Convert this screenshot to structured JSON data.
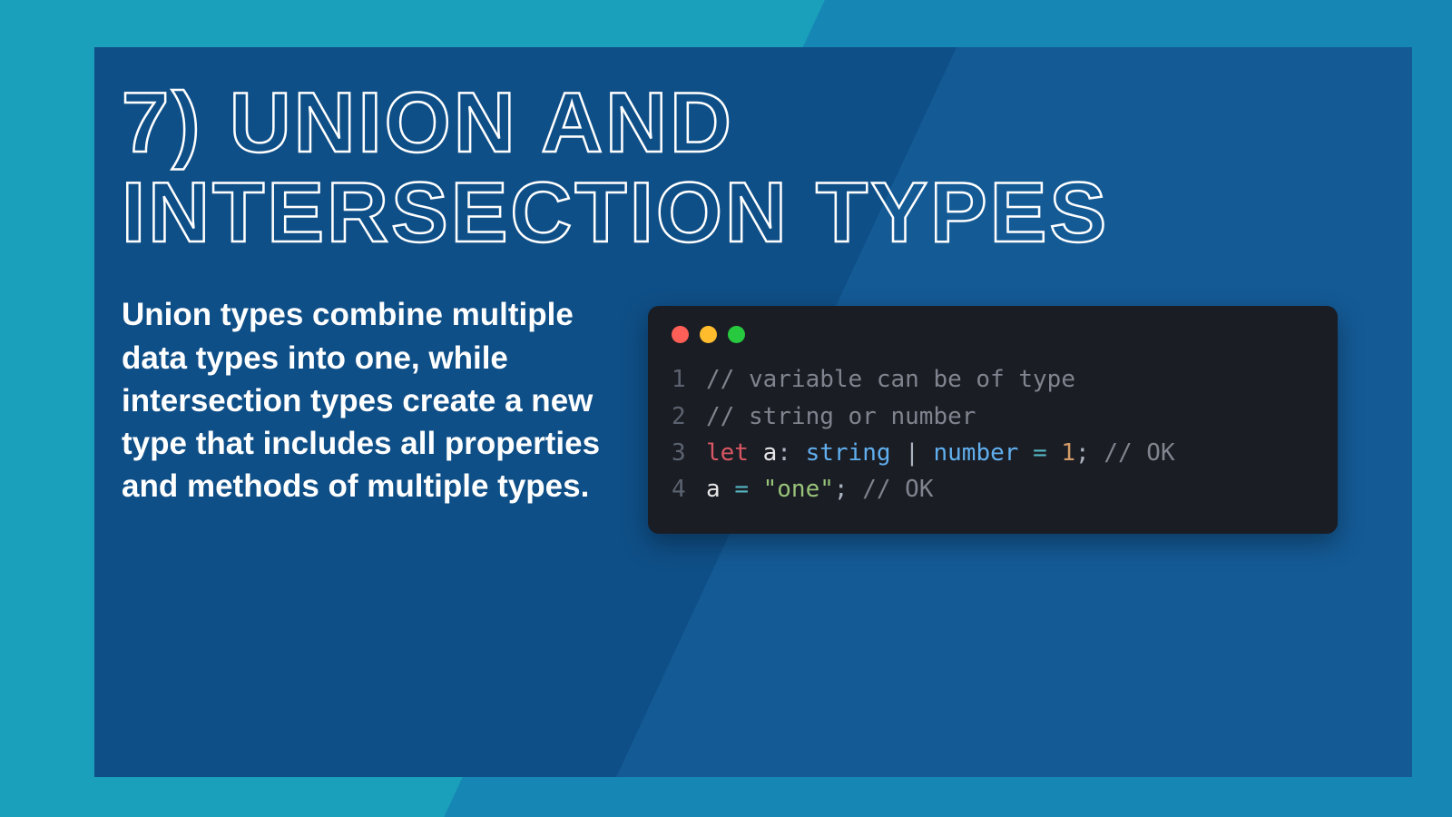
{
  "title": "7) Union and Intersection Types",
  "description": "Union types combine multiple data types into one, while intersection types create a new type that includes all properties and methods of multiple types.",
  "code": {
    "lines": [
      {
        "n": "1",
        "tokens": [
          {
            "t": "// variable can be of type",
            "c": "cmt"
          }
        ]
      },
      {
        "n": "2",
        "tokens": [
          {
            "t": "// string or number",
            "c": "cmt"
          }
        ]
      },
      {
        "n": "3",
        "tokens": [
          {
            "t": "let",
            "c": "kw2"
          },
          {
            "t": " ",
            "c": ""
          },
          {
            "t": "a",
            "c": "id"
          },
          {
            "t": ": ",
            "c": "punc"
          },
          {
            "t": "string",
            "c": "type"
          },
          {
            "t": " | ",
            "c": "punc"
          },
          {
            "t": "number",
            "c": "type"
          },
          {
            "t": " ",
            "c": ""
          },
          {
            "t": "=",
            "c": "op"
          },
          {
            "t": " ",
            "c": ""
          },
          {
            "t": "1",
            "c": "num"
          },
          {
            "t": ";",
            "c": "punc"
          },
          {
            "t": " ",
            "c": ""
          },
          {
            "t": "// OK",
            "c": "cmt"
          }
        ]
      },
      {
        "n": "4",
        "tokens": [
          {
            "t": "a",
            "c": "id"
          },
          {
            "t": " ",
            "c": ""
          },
          {
            "t": "=",
            "c": "op"
          },
          {
            "t": " ",
            "c": ""
          },
          {
            "t": "\"one\"",
            "c": "str"
          },
          {
            "t": ";",
            "c": "punc"
          },
          {
            "t": " ",
            "c": ""
          },
          {
            "t": "// OK",
            "c": "cmt"
          }
        ]
      }
    ]
  }
}
